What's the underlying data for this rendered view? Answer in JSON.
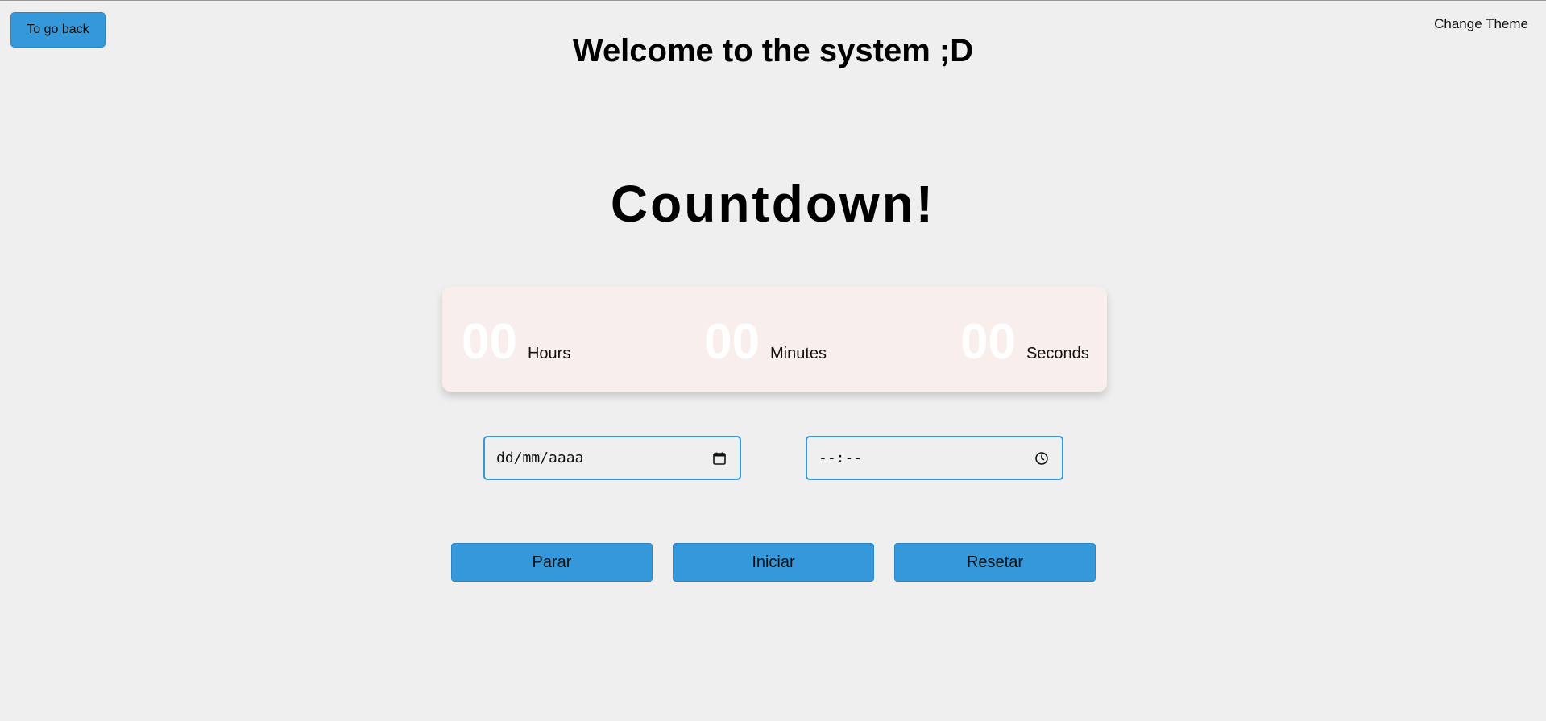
{
  "header": {
    "back_label": "To go back",
    "theme_label": "Change Theme",
    "welcome": "Welcome to the system ;D"
  },
  "main": {
    "title": "Countdown!",
    "timer": {
      "hours_value": "00",
      "hours_label": "Hours",
      "minutes_value": "00",
      "minutes_label": "Minutes",
      "seconds_value": "00",
      "seconds_label": "Seconds"
    },
    "date_input": {
      "placeholder": "dd/mm/aaaa",
      "icon": "calendar-icon"
    },
    "time_input": {
      "placeholder": "--:--",
      "icon": "clock-icon"
    },
    "buttons": {
      "stop": "Parar",
      "start": "Iniciar",
      "reset": "Resetar"
    }
  },
  "colors": {
    "accent": "#3498db",
    "background": "#efefef",
    "card": "#f8efed",
    "digits": "#ffffff"
  }
}
